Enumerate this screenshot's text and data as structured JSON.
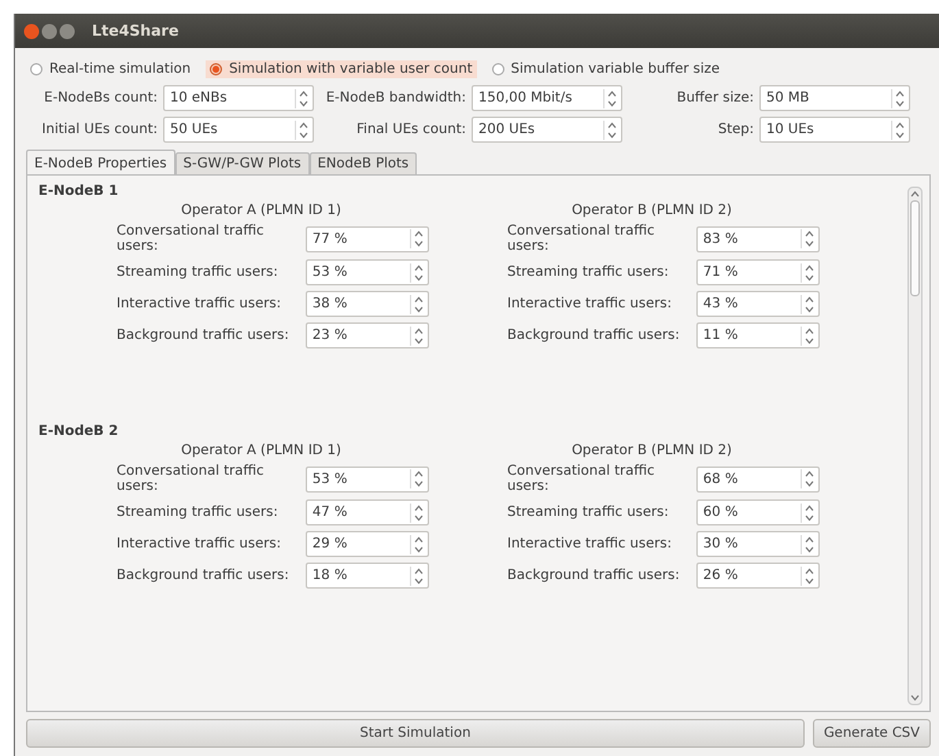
{
  "window": {
    "title": "Lte4Share"
  },
  "modes": [
    {
      "label": "Real-time simulation",
      "selected": false
    },
    {
      "label": "Simulation with variable user count",
      "selected": true
    },
    {
      "label": "Simulation variable buffer size",
      "selected": false
    }
  ],
  "settings": [
    {
      "label": "E-NodeBs count:",
      "value": "10 eNBs"
    },
    {
      "label": "E-NodeB bandwidth:",
      "value": "150,00 Mbit/s"
    },
    {
      "label": "Buffer size:",
      "value": "50 MB"
    },
    {
      "label": "Initial UEs count:",
      "value": "50 UEs"
    },
    {
      "label": "Final UEs count:",
      "value": "200 UEs"
    },
    {
      "label": "Step:",
      "value": "10 UEs"
    }
  ],
  "tabs": [
    {
      "label": "E-NodeB Properties",
      "selected": true
    },
    {
      "label": "S-GW/P-GW Plots",
      "selected": false
    },
    {
      "label": "ENodeB Plots",
      "selected": false
    }
  ],
  "enodebs": [
    {
      "title": "E-NodeB 1",
      "operators": [
        {
          "title": "Operator A (PLMN ID 1)",
          "rows": [
            {
              "label": "Conversational traffic users:",
              "value": "77 %"
            },
            {
              "label": "Streaming traffic users:",
              "value": "53 %"
            },
            {
              "label": "Interactive traffic users:",
              "value": "38 %"
            },
            {
              "label": "Background traffic users:",
              "value": "23 %"
            }
          ]
        },
        {
          "title": "Operator B (PLMN ID 2)",
          "rows": [
            {
              "label": "Conversational traffic users:",
              "value": "83 %"
            },
            {
              "label": "Streaming traffic users:",
              "value": "71 %"
            },
            {
              "label": "Interactive traffic users:",
              "value": "43 %"
            },
            {
              "label": "Background traffic users:",
              "value": "11 %"
            }
          ]
        }
      ]
    },
    {
      "title": "E-NodeB 2",
      "operators": [
        {
          "title": "Operator A (PLMN ID 1)",
          "rows": [
            {
              "label": "Conversational traffic users:",
              "value": "53 %"
            },
            {
              "label": "Streaming traffic users:",
              "value": "47 %"
            },
            {
              "label": "Interactive traffic users:",
              "value": "29 %"
            },
            {
              "label": "Background traffic users:",
              "value": "18 %"
            }
          ]
        },
        {
          "title": "Operator B (PLMN ID 2)",
          "rows": [
            {
              "label": "Conversational traffic users:",
              "value": "68 %"
            },
            {
              "label": "Streaming traffic users:",
              "value": "60 %"
            },
            {
              "label": "Interactive traffic users:",
              "value": "30 %"
            },
            {
              "label": "Background traffic users:",
              "value": "26 %"
            }
          ]
        }
      ]
    }
  ],
  "buttons": [
    "Start Simulation",
    "Generate CSV"
  ]
}
